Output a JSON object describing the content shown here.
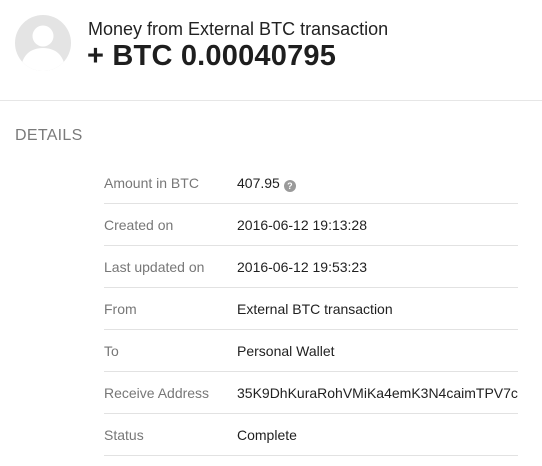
{
  "header": {
    "subtitle": "Money from External BTC transaction",
    "amount": "+ BTC 0.00040795",
    "avatar_icon": "user-avatar-placeholder-icon"
  },
  "details": {
    "section_title": "DETAILS",
    "rows": [
      {
        "label": "Amount in BTC",
        "value": "407.95",
        "help_icon": "question-icon"
      },
      {
        "label": "Created on",
        "value": "2016-06-12 19:13:28"
      },
      {
        "label": "Last updated on",
        "value": "2016-06-12 19:53:23"
      },
      {
        "label": "From",
        "value": "External BTC transaction"
      },
      {
        "label": "To",
        "value": "Personal Wallet"
      },
      {
        "label": "Receive Address",
        "value": "35K9DhKuraRohVMiKa4emK3N4caimTPV7c"
      },
      {
        "label": "Status",
        "value": "Complete"
      }
    ]
  },
  "colors": {
    "avatar_bg": "#e4e4e4",
    "avatar_fg": "#ffffff",
    "label": "#777777",
    "value": "#1f1f1f",
    "section_title": "#7a7a7a",
    "divider": "#e2e2e2"
  }
}
